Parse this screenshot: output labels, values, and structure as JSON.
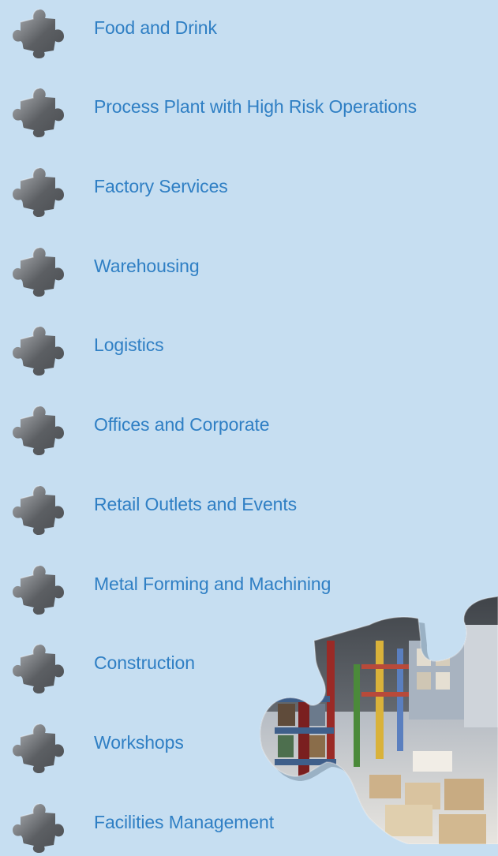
{
  "colors": {
    "background": "#c6def1",
    "link": "#2f7fc4",
    "icon_dark": "#5c5f63",
    "icon_light": "#b3b6ba"
  },
  "menu": {
    "items": [
      {
        "label": "Food and Drink",
        "icon": "puzzle-piece-icon"
      },
      {
        "label": "Process Plant with High Risk Operations",
        "icon": "puzzle-piece-icon"
      },
      {
        "label": "Factory Services",
        "icon": "puzzle-piece-icon"
      },
      {
        "label": "Warehousing",
        "icon": "puzzle-piece-icon"
      },
      {
        "label": "Logistics",
        "icon": "puzzle-piece-icon"
      },
      {
        "label": "Offices and Corporate",
        "icon": "puzzle-piece-icon"
      },
      {
        "label": "Retail Outlets and Events",
        "icon": "puzzle-piece-icon"
      },
      {
        "label": "Metal Forming and Machining",
        "icon": "puzzle-piece-icon"
      },
      {
        "label": "Construction",
        "icon": "puzzle-piece-icon"
      },
      {
        "label": "Workshops",
        "icon": "puzzle-piece-icon"
      },
      {
        "label": "Facilities Management",
        "icon": "puzzle-piece-icon"
      }
    ]
  },
  "photo": {
    "subject": "warehouse-puzzle-photo"
  }
}
